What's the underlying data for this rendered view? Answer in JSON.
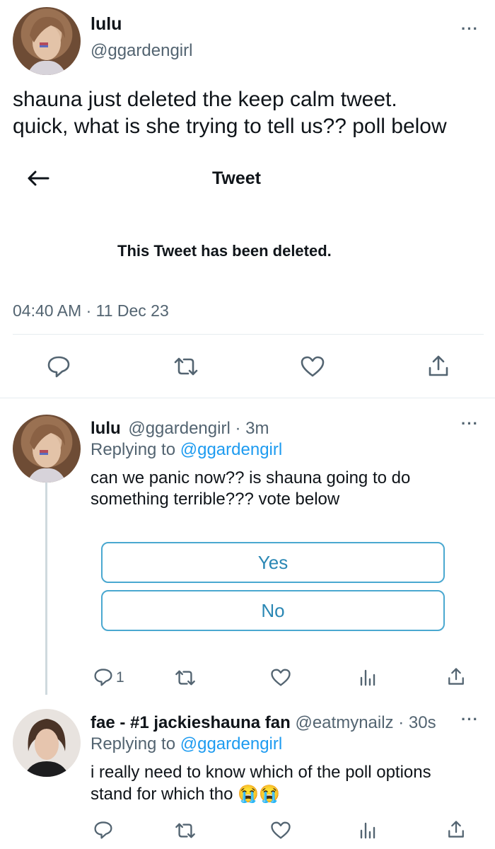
{
  "main_tweet": {
    "display_name": "lulu",
    "handle": "@ggardengirl",
    "text_line1": "shauna just deleted the keep calm tweet.",
    "text_line2": "quick, what is she trying to tell us?? poll below",
    "embedded": {
      "header_title": "Tweet",
      "deleted_message": "This Tweet has been deleted."
    },
    "timestamp": "04:40 AM · 11 Dec 23"
  },
  "reply1": {
    "display_name": "lulu",
    "handle_time": "@ggardengirl · 3m",
    "replying_label": "Replying to",
    "replying_handle": "@ggardengirl",
    "text_line1": "can we panic now?? is shauna going to do",
    "text_line2": "something terrible??? vote below",
    "poll_options": [
      "Yes",
      "No"
    ],
    "reply_count": "1"
  },
  "reply2": {
    "display_name": "fae - #1 jackieshauna fan",
    "handle_time": "@eatmynailz · 30s",
    "replying_label": "Replying to",
    "replying_handle": "@ggardengirl",
    "text_line1": "i really need to know which of the poll options",
    "text_line2": "stand for which tho",
    "emoji": "😭😭"
  },
  "icons": [
    "reply-icon",
    "retweet-icon",
    "like-icon",
    "analytics-icon",
    "share-icon",
    "back-arrow-icon",
    "more-icon"
  ]
}
